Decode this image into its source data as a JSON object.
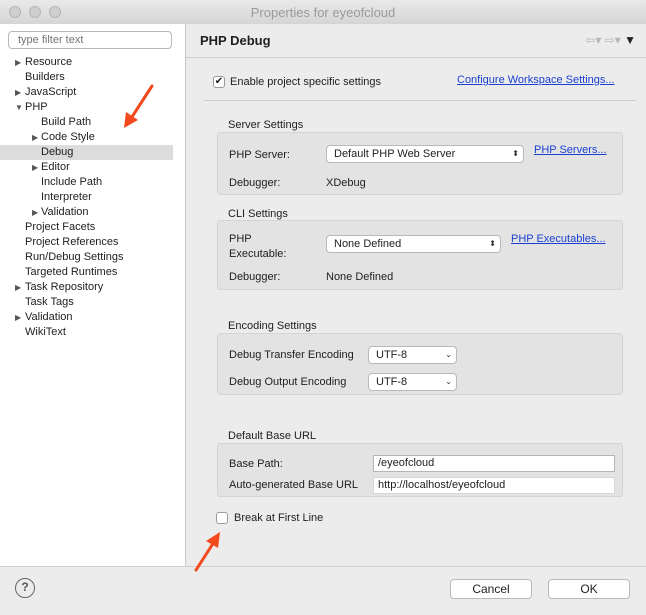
{
  "window": {
    "title": "Properties for eyeofcloud"
  },
  "filter": {
    "placeholder": "type filter text"
  },
  "tree": [
    {
      "label": "Resource",
      "expandable": true,
      "expanded": false,
      "level": 0
    },
    {
      "label": "Builders",
      "expandable": false,
      "level": 0
    },
    {
      "label": "JavaScript",
      "expandable": true,
      "expanded": false,
      "level": 0
    },
    {
      "label": "PHP",
      "expandable": true,
      "expanded": true,
      "level": 0
    },
    {
      "label": "Build Path",
      "expandable": false,
      "level": 1
    },
    {
      "label": "Code Style",
      "expandable": true,
      "expanded": false,
      "level": 1
    },
    {
      "label": "Debug",
      "expandable": false,
      "level": 1,
      "selected": true
    },
    {
      "label": "Editor",
      "expandable": true,
      "expanded": false,
      "level": 1
    },
    {
      "label": "Include Path",
      "expandable": false,
      "level": 1
    },
    {
      "label": "Interpreter",
      "expandable": false,
      "level": 1
    },
    {
      "label": "Validation",
      "expandable": true,
      "expanded": false,
      "level": 1
    },
    {
      "label": "Project Facets",
      "expandable": false,
      "level": 0
    },
    {
      "label": "Project References",
      "expandable": false,
      "level": 0
    },
    {
      "label": "Run/Debug Settings",
      "expandable": false,
      "level": 0
    },
    {
      "label": "Targeted Runtimes",
      "expandable": false,
      "level": 0
    },
    {
      "label": "Task Repository",
      "expandable": true,
      "expanded": false,
      "level": 0
    },
    {
      "label": "Task Tags",
      "expandable": false,
      "level": 0
    },
    {
      "label": "Validation",
      "expandable": true,
      "expanded": false,
      "level": 0
    },
    {
      "label": "WikiText",
      "expandable": false,
      "level": 0
    }
  ],
  "page": {
    "title": "PHP Debug",
    "enable_specific": "Enable project specific settings",
    "enable_checked": true,
    "configure_link": "Configure Workspace Settings...",
    "server": {
      "title": "Server Settings",
      "php_server_label": "PHP Server:",
      "php_server_value": "Default PHP Web Server",
      "php_servers_link": "PHP Servers...",
      "debugger_label": "Debugger:",
      "debugger_value": "XDebug"
    },
    "cli": {
      "title": "CLI Settings",
      "exe_label_1": "PHP",
      "exe_label_2": "Executable:",
      "exe_value": "None Defined",
      "exe_link": "PHP Executables...",
      "debugger_label": "Debugger:",
      "debugger_value": "None Defined"
    },
    "encoding": {
      "title": "Encoding Settings",
      "transfer_label": "Debug Transfer Encoding",
      "transfer_value": "UTF-8",
      "output_label": "Debug Output Encoding",
      "output_value": "UTF-8"
    },
    "base_url": {
      "title": "Default Base URL",
      "base_path_label": "Base Path:",
      "base_path_value": "/eyeofcloud",
      "auto_label": "Auto-generated Base URL",
      "auto_value": "http://localhost/eyeofcloud"
    },
    "break_first_line": "Break at First Line",
    "break_checked": false
  },
  "footer": {
    "help": "?",
    "cancel": "Cancel",
    "ok": "OK"
  },
  "icons": {
    "back": "back-arrow-icon",
    "forward": "forward-arrow-icon",
    "menu": "menu-triangle-icon"
  },
  "colors": {
    "link": "#1a3fd1",
    "annotation_arrow": "#f24a1d",
    "selection": "#dcdcdc"
  }
}
